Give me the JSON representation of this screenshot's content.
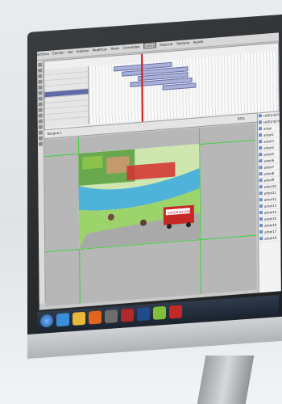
{
  "menu": [
    "Archivo",
    "Edición",
    "Ver",
    "Insertar",
    "Modificar",
    "Texto",
    "Comandos",
    "Control",
    "Depurar",
    "Ventana",
    "Ayuda"
  ],
  "layers": [
    "",
    "",
    "",
    "",
    "",
    "",
    "",
    "",
    ""
  ],
  "doc_tab": "Escena 1",
  "zoom": "60%",
  "canvas_sign": "EXPORTACION",
  "library_items": [
    "HORZ3DS",
    "HORZ3EYE",
    "arbol",
    "arbol2",
    "arbol3",
    "arbol4",
    "arbol5",
    "arbol6",
    "arbol7",
    "arbol8",
    "arbol9",
    "arbol10",
    "arbol11",
    "arbol12",
    "arbol13",
    "arbol14",
    "arbol15",
    "arbol16",
    "arbol17",
    "arbol18"
  ],
  "colors": {
    "guide": "#3cd23c",
    "playhead": "#d21919",
    "frame_span": "#a9b0d8",
    "selected_layer": "#5e6ba8"
  },
  "taskbar_icons": [
    "start-orb-icon",
    "ie-icon",
    "folder-icon",
    "media-icon",
    "app-icon",
    "flash-icon",
    "photoshop-icon",
    "app2-icon",
    "app3-icon"
  ]
}
